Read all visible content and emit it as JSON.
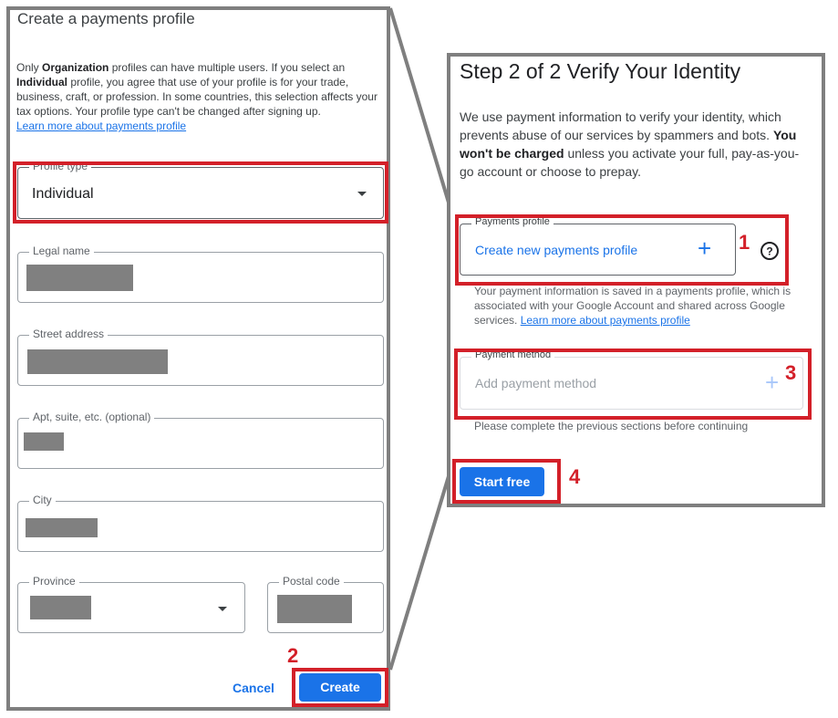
{
  "left_panel": {
    "title": "Create a payments profile",
    "description": {
      "p1": "Only ",
      "b1": "Organization",
      "p2": " profiles can have multiple users. If you select an ",
      "b2": "Individual",
      "p3": " profile, you agree that use of your profile is for your trade, business, craft, or profession. In some countries, this selection affects your tax options. Your profile type can't be changed after signing up.",
      "link": "Learn more about payments profile"
    },
    "profile_type": {
      "label": "Profile type",
      "value": "Individual"
    },
    "legal_name": {
      "label": "Legal name"
    },
    "street_address": {
      "label": "Street address"
    },
    "apt": {
      "label": "Apt, suite, etc. (optional)"
    },
    "city": {
      "label": "City"
    },
    "province": {
      "label": "Province"
    },
    "postal_code": {
      "label": "Postal code"
    },
    "cancel_label": "Cancel",
    "create_label": "Create"
  },
  "right_panel": {
    "title_step": "Step 2 of 2",
    "title_rest": " Verify Your Identity",
    "description": {
      "p1": "We use payment information to verify your identity, which prevents abuse of our services by spammers and bots. ",
      "b1": "You won't be charged",
      "p2": " unless you activate your full, pay-as-you-go account or choose to prepay."
    },
    "payments_profile": {
      "label": "Payments profile",
      "value": "Create new payments profile"
    },
    "profile_note": "Your payment information is saved in a payments profile, which is associated with your Google Account and shared across Google services. ",
    "profile_note_link": "Learn more about payments profile",
    "payment_method": {
      "label": "Payment method",
      "placeholder": "Add payment method"
    },
    "payment_note": "Please complete the previous sections before continuing",
    "start_label": "Start free"
  },
  "annotations": {
    "n1": "1",
    "n2": "2",
    "n3": "3",
    "n4": "4"
  },
  "colors": {
    "accent": "#1a73e8",
    "highlight": "#d32029",
    "redaction": "#808080",
    "frame": "#7f7f7f"
  }
}
